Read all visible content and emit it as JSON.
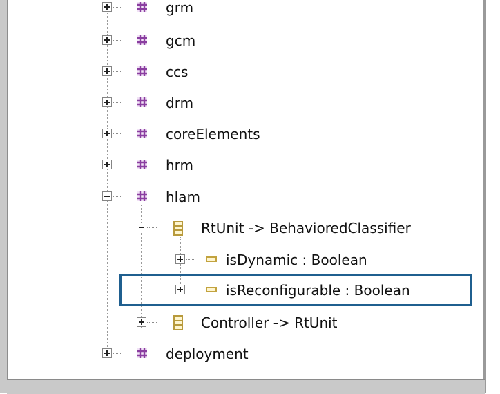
{
  "tree": {
    "packages": [
      {
        "label": "grm",
        "expanded": false
      },
      {
        "label": "gcm",
        "expanded": false
      },
      {
        "label": "ccs",
        "expanded": false
      },
      {
        "label": "drm",
        "expanded": false
      },
      {
        "label": "coreElements",
        "expanded": false
      },
      {
        "label": "hrm",
        "expanded": false
      },
      {
        "label": "hlam",
        "expanded": true
      },
      {
        "label": "deployment",
        "expanded": false
      }
    ],
    "hlam_children": [
      {
        "label": "RtUnit -> BehavioredClassifier",
        "expanded": true
      },
      {
        "label": "Controller -> RtUnit",
        "expanded": false
      }
    ],
    "rtunit_attributes": [
      {
        "label": "isDynamic : Boolean"
      },
      {
        "label": "isReconfigurable : Boolean"
      }
    ]
  },
  "colors": {
    "package_icon": "#8a3ea0",
    "class_icon_border": "#b89a3c",
    "highlight_border": "#1f5f8f"
  }
}
